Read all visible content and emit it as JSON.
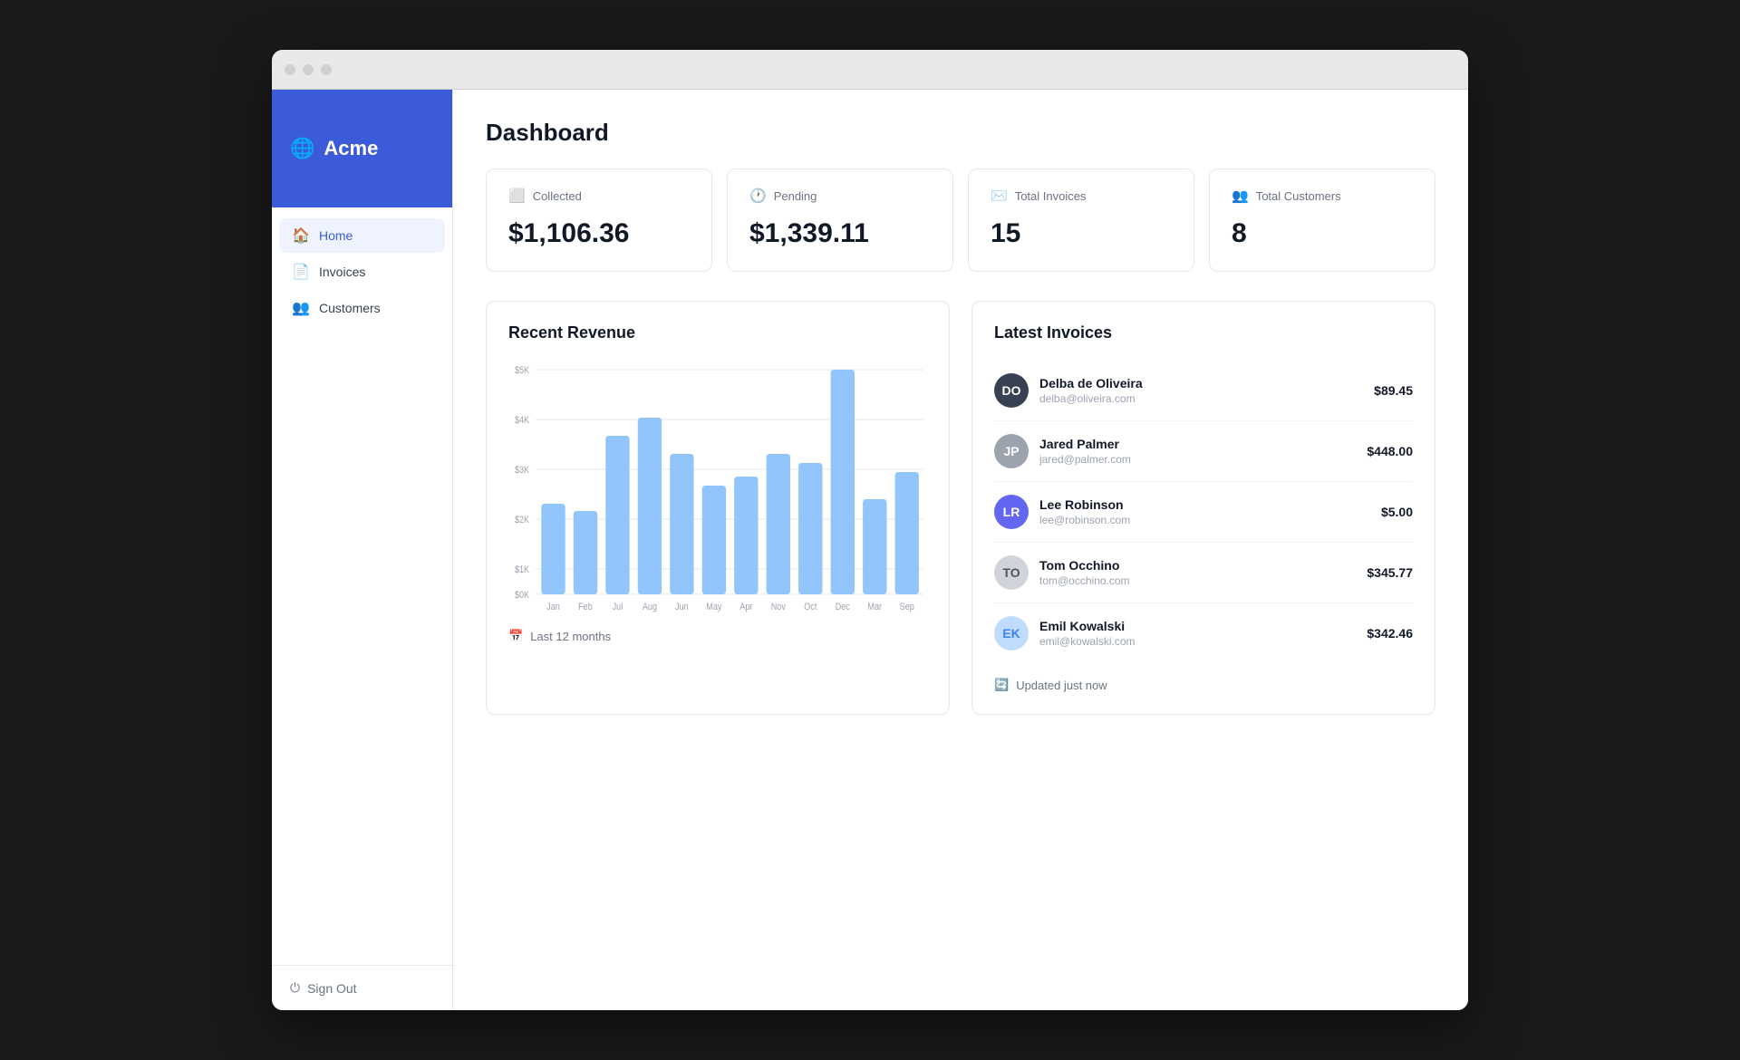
{
  "app": {
    "brand": "Acme",
    "page_title": "Dashboard"
  },
  "sidebar": {
    "nav_items": [
      {
        "id": "home",
        "label": "Home",
        "active": true
      },
      {
        "id": "invoices",
        "label": "Invoices",
        "active": false
      },
      {
        "id": "customers",
        "label": "Customers",
        "active": false
      }
    ],
    "sign_out_label": "Sign Out"
  },
  "stats": [
    {
      "id": "collected",
      "label": "Collected",
      "value": "$1,106.36",
      "icon": "💳"
    },
    {
      "id": "pending",
      "label": "Pending",
      "value": "$1,339.11",
      "icon": "🕐"
    },
    {
      "id": "total_invoices",
      "label": "Total Invoices",
      "value": "15",
      "icon": "📋"
    },
    {
      "id": "total_customers",
      "label": "Total Customers",
      "value": "8",
      "icon": "👥"
    }
  ],
  "recent_revenue": {
    "title": "Recent Revenue",
    "footer": "Last 12 months",
    "bars": [
      {
        "month": "Jan",
        "value": 2000,
        "height_pct": 40
      },
      {
        "month": "Feb",
        "value": 1800,
        "height_pct": 36
      },
      {
        "month": "Jul",
        "value": 3500,
        "height_pct": 70
      },
      {
        "month": "Aug",
        "value": 3900,
        "height_pct": 78
      },
      {
        "month": "Jun",
        "value": 3100,
        "height_pct": 62
      },
      {
        "month": "May",
        "value": 2400,
        "height_pct": 48
      },
      {
        "month": "Apr",
        "value": 2600,
        "height_pct": 52
      },
      {
        "month": "Nov",
        "value": 3100,
        "height_pct": 62
      },
      {
        "month": "Oct",
        "value": 2900,
        "height_pct": 58
      },
      {
        "month": "Dec",
        "value": 4900,
        "height_pct": 98
      },
      {
        "month": "Mar",
        "value": 2100,
        "height_pct": 42
      },
      {
        "month": "Sep",
        "value": 2700,
        "height_pct": 54
      }
    ],
    "y_labels": [
      "$5K",
      "$4K",
      "$3K",
      "$2K",
      "$1K",
      "$0K"
    ]
  },
  "latest_invoices": {
    "title": "Latest Invoices",
    "footer": "Updated just now",
    "items": [
      {
        "name": "Delba de Oliveira",
        "email": "delba@oliveira.com",
        "amount": "$89.45",
        "initials": "DO",
        "color": "delba"
      },
      {
        "name": "Jared Palmer",
        "email": "jared@palmer.com",
        "amount": "$448.00",
        "initials": "JP",
        "color": "jared"
      },
      {
        "name": "Lee Robinson",
        "email": "lee@robinson.com",
        "amount": "$5.00",
        "initials": "LR",
        "color": "lee"
      },
      {
        "name": "Tom Occhino",
        "email": "tom@occhino.com",
        "amount": "$345.77",
        "initials": "TO",
        "color": "tom"
      },
      {
        "name": "Emil Kowalski",
        "email": "emil@kowalski.com",
        "amount": "$342.46",
        "initials": "EK",
        "color": "emil"
      }
    ]
  }
}
